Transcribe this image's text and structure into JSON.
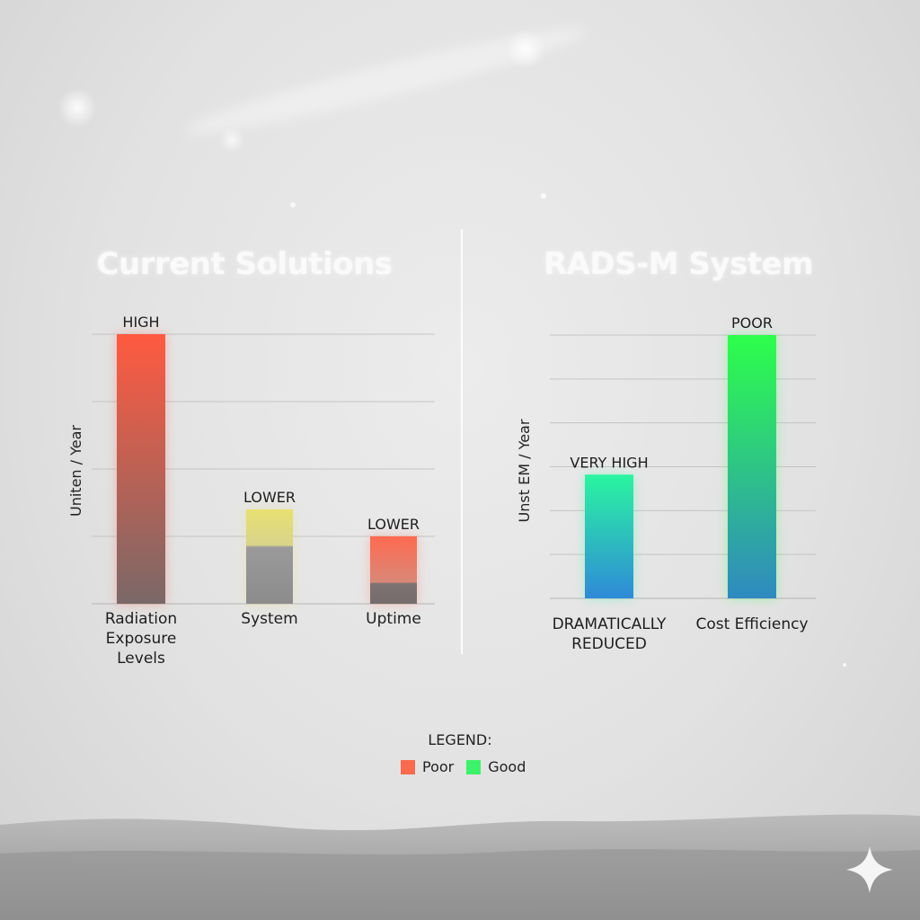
{
  "chart_data": [
    {
      "type": "bar",
      "title": "Current Solutions",
      "ylabel": "Uniten / Year",
      "categories": [
        "Radiation Exposure Levels",
        "System",
        "Uptime"
      ],
      "values": [
        1.0,
        0.35,
        0.25
      ],
      "ylim": [
        0,
        1
      ],
      "value_labels": [
        "HIGH",
        "LOWER",
        "LOWER"
      ],
      "bar_colors": [
        "#ff5a40",
        "#e8e070",
        "#ff6a50"
      ],
      "grid": true
    },
    {
      "type": "bar",
      "title": "RADS-M System",
      "ylabel": "Unst EM / Year",
      "categories": [
        "DRAMATICALLY REDUCED",
        "Cost Efficiency"
      ],
      "values": [
        0.47,
        1.0
      ],
      "ylim": [
        0,
        1
      ],
      "value_labels": [
        "VERY HIGH",
        "POOR"
      ],
      "bar_colors": [
        "#2af5a0",
        "#2dff4a"
      ],
      "grid": true
    }
  ],
  "legend": {
    "title": "LEGEND:",
    "items": [
      {
        "label": "Poor",
        "color": "#f96a4e"
      },
      {
        "label": "Good",
        "color": "#3cf26a"
      }
    ]
  }
}
